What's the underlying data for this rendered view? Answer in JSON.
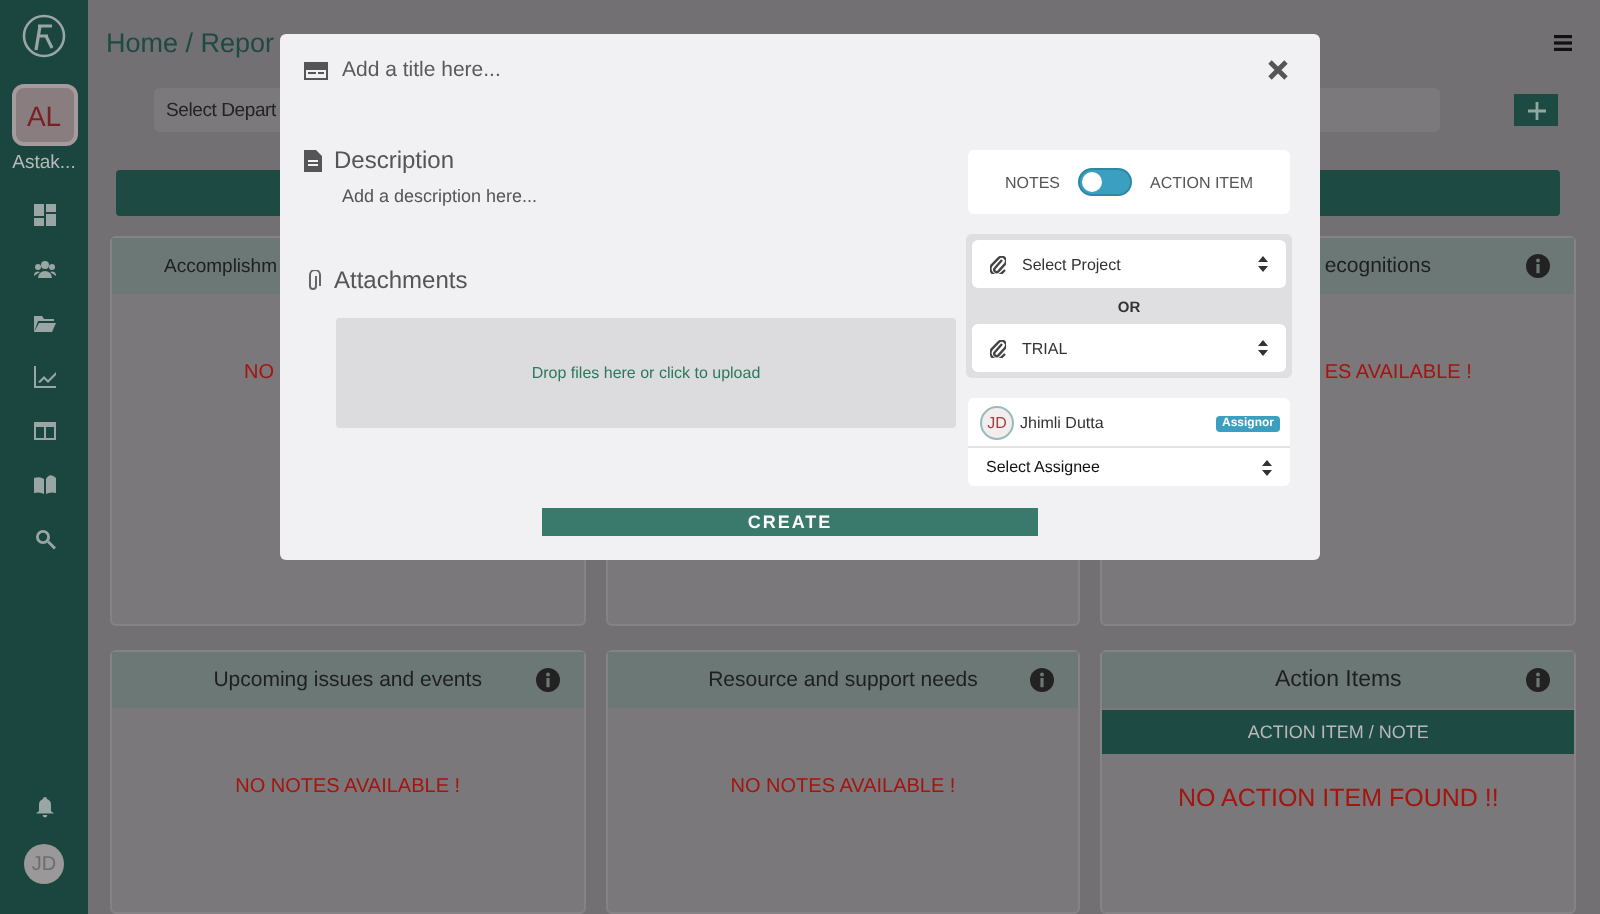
{
  "sidebar": {
    "avatar": "AL",
    "user_name": "Astak...",
    "bottom_avatar": "JD"
  },
  "header": {
    "breadcrumb": "Home / Repor"
  },
  "filters": {
    "department_placeholder": "Select Depart"
  },
  "cards": [
    {
      "kind": "notes",
      "title": "Accomplishm",
      "message": "NO"
    },
    {
      "kind": "notes"
    },
    {
      "kind": "notes",
      "title": "ecognitions",
      "message": "ES AVAILABLE !"
    },
    {
      "kind": "notes",
      "title": "Upcoming issues and events",
      "message": "NO NOTES AVAILABLE !"
    },
    {
      "kind": "notes",
      "title": "Resource and support needs",
      "message": "NO NOTES AVAILABLE !"
    },
    {
      "kind": "action_items",
      "title": "Action Items",
      "column_header": "ACTION ITEM / NOTE",
      "message": "NO ACTION ITEM FOUND !!"
    }
  ],
  "modal": {
    "title_placeholder": "Add a title here...",
    "description": {
      "label": "Description",
      "placeholder": "Add a description here..."
    },
    "attachments": {
      "label": "Attachments",
      "dropzone": "Drop files here or click to upload"
    },
    "type_toggle": {
      "left_label": "NOTES",
      "right_label": "ACTION ITEM",
      "on": false
    },
    "project_select": "Select Project",
    "or_label": "OR",
    "project_value": "TRIAL",
    "assignor": {
      "initials": "JD",
      "name": "Jhimli Dutta",
      "badge": "Assignor"
    },
    "assignee_select": "Select Assignee",
    "create_button": "CREATE"
  }
}
